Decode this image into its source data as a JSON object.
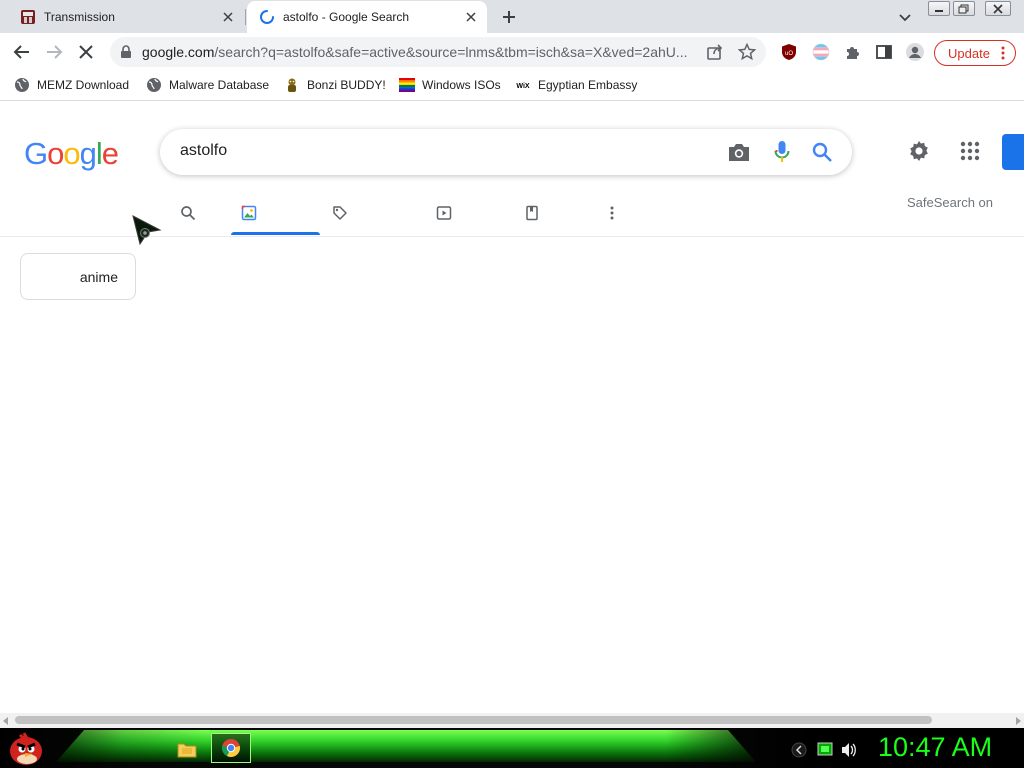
{
  "browser": {
    "tabs": [
      {
        "title": "Transmission",
        "active": false,
        "icon": "transmission-icon"
      },
      {
        "title": "astolfo - Google Search",
        "active": true,
        "icon": "loading-spinner-icon"
      }
    ],
    "address_bar": {
      "url_host": "google.com",
      "url_path": "/search?q=astolfo&safe=active&source=lnms&tbm=isch&sa=X&ved=2ahU..."
    },
    "update_button_label": "Update",
    "bookmarks": [
      {
        "label": "MEMZ Download",
        "icon": "globe-icon"
      },
      {
        "label": "Malware Database",
        "icon": "globe-icon"
      },
      {
        "label": "Bonzi BUDDY!",
        "icon": "bonzi-icon"
      },
      {
        "label": "Windows ISOs",
        "icon": "rainbow-flag-icon"
      },
      {
        "label": "Egyptian Embassy",
        "icon": "wix-icon"
      }
    ]
  },
  "google": {
    "logo_letters": [
      {
        "ch": "G",
        "color": "#4285F4"
      },
      {
        "ch": "o",
        "color": "#EA4335"
      },
      {
        "ch": "o",
        "color": "#FBBC05"
      },
      {
        "ch": "g",
        "color": "#4285F4"
      },
      {
        "ch": "l",
        "color": "#34A853"
      },
      {
        "ch": "e",
        "color": "#EA4335"
      }
    ],
    "query": "astolfo",
    "safesearch_label": "SafeSearch on",
    "active_filter": "images",
    "filter_tabs": [
      "all-search",
      "images",
      "shopping",
      "videos",
      "books",
      "more"
    ],
    "chips": [
      "anime"
    ]
  },
  "taskbar": {
    "clock": "10:47 AM",
    "accent_color": "#19ff19"
  }
}
